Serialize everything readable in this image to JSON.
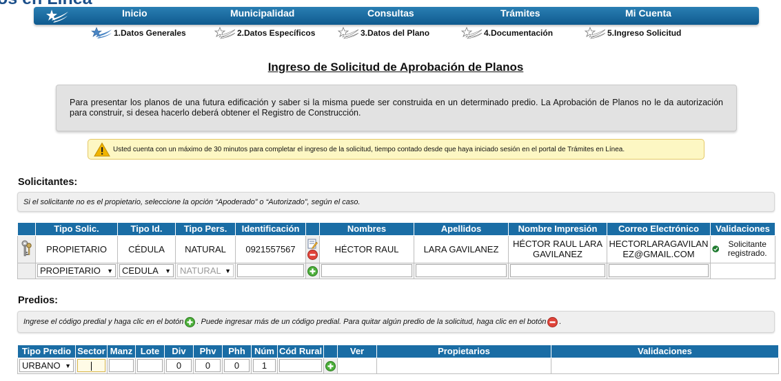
{
  "site": {
    "title": "os en Línea"
  },
  "nav": {
    "logo_icon": "star-swoosh-icon",
    "items": [
      "Inicio",
      "Municipalidad",
      "Consultas",
      "Trámites",
      "Mi Cuenta"
    ]
  },
  "steps": [
    "1.Datos Generales",
    "2.Datos Específicos",
    "3.Datos del Plano",
    "4.Documentación",
    "5.Ingreso Solicitud"
  ],
  "page": {
    "title": "Ingreso de Solicitud de Aprobación de Planos",
    "info_text": "Para presentar los planos de una futura edificación y saber si la misma puede ser construida en un determinado predio. La Aprobación de Planos no le da autorización para construir, si desea hacerlo deberá obtener el Registro de Construcción.",
    "warning_text": "Usted cuenta con un máximo de 30 minutos para completar el ingreso de la solicitud, tiempo contado desde que haya iniciado sesión en el portal de Trámites en Línea."
  },
  "solicitantes": {
    "title": "Solicitantes:",
    "note": "Si el solicitante no es el propietario, seleccione la opción “Apoderado” o “Autorizado”, según el caso.",
    "headers": [
      "Tipo Solic.",
      "Tipo Id.",
      "Tipo Pers.",
      "Identificación",
      "Nombres",
      "Apellidos",
      "Nombre Impresión",
      "Correo Electrónico",
      "Validaciones"
    ],
    "row": {
      "tipo_solic": "PROPIETARIO",
      "tipo_id": "CÉDULA",
      "tipo_pers": "NATURAL",
      "identificacion": "0921557567",
      "nombres": "HÉCTOR RAUL",
      "apellidos": "LARA GAVILANEZ",
      "nombre_impresion": "HÉCTOR RAUL LARA GAVILANEZ",
      "correo": "HECTORLARAGAVILANEZ@GMAIL.COM",
      "validacion": "Solicitante registrado."
    },
    "new_row": {
      "tipo_solic": "PROPIETARIO",
      "tipo_id": "CEDULA",
      "tipo_pers": "NATURAL"
    }
  },
  "predios": {
    "title": "Predios:",
    "note_part1": "Ingrese el código predial y haga clic en el botón",
    "note_part2": ". Puede ingresar más de un código predial. Para quitar algún predio de la solicitud, haga clic en el botón",
    "note_part3": ".",
    "headers": [
      "Tipo Predio",
      "Sector",
      "Manz",
      "Lote",
      "Div",
      "Phv",
      "Phh",
      "Núm",
      "Cód Rural",
      "Ver",
      "Propietarios",
      "Validaciones"
    ],
    "new_row": {
      "tipo_predio": "URBANO",
      "sector": "",
      "manz": "",
      "lote": "",
      "div": "0",
      "phv": "0",
      "phh": "0",
      "num": "1",
      "cod_rural": ""
    }
  },
  "colors": {
    "nav_blue": "#1a6da5",
    "add_green": "#4caf3a",
    "remove_red": "#e0443a",
    "warning_yellow": "#fdf7c3"
  }
}
